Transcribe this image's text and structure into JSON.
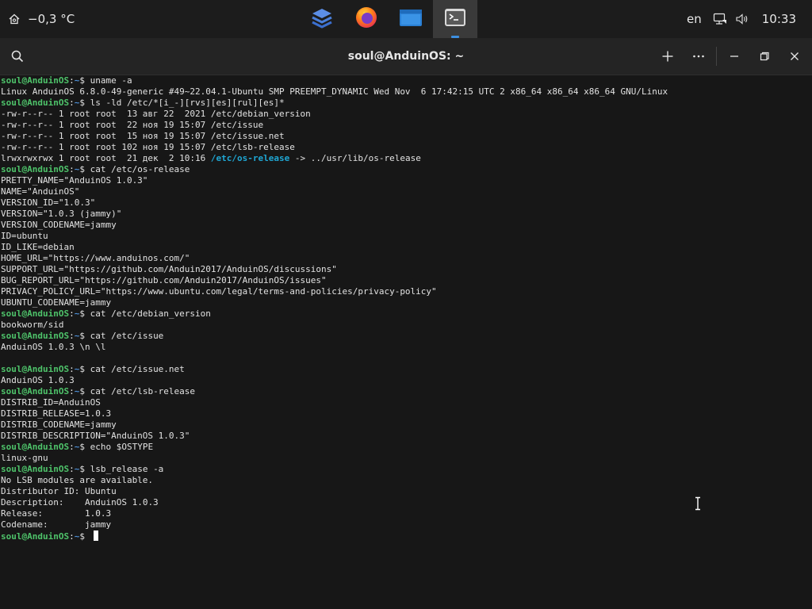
{
  "topbar": {
    "weather_text": "−0,3 °C",
    "dock": [
      {
        "name": "stack-app-icon"
      },
      {
        "name": "firefox-icon"
      },
      {
        "name": "files-icon"
      },
      {
        "name": "terminal-icon",
        "active": true
      }
    ],
    "language": "en",
    "clock": "10:33"
  },
  "window": {
    "title": "soul@AnduinOS: ~"
  },
  "terminal": {
    "prompt_user": "soul@AnduinOS",
    "prompt_path": "~",
    "prompt_symbol": "$",
    "lines": [
      {
        "type": "cmd",
        "text": "uname -a"
      },
      {
        "type": "out",
        "text": "Linux AnduinOS 6.8.0-49-generic #49~22.04.1-Ubuntu SMP PREEMPT_DYNAMIC Wed Nov  6 17:42:15 UTC 2 x86_64 x86_64 x86_64 GNU/Linux"
      },
      {
        "type": "cmd",
        "text": "ls -ld /etc/*[i_-][rvs][es][rul][es]*"
      },
      {
        "type": "out",
        "text": "-rw-r--r-- 1 root root  13 авг 22  2021 /etc/debian_version"
      },
      {
        "type": "out",
        "text": "-rw-r--r-- 1 root root  22 ноя 19 15:07 /etc/issue"
      },
      {
        "type": "out",
        "text": "-rw-r--r-- 1 root root  15 ноя 19 15:07 /etc/issue.net"
      },
      {
        "type": "out",
        "text": "-rw-r--r-- 1 root root 102 ноя 19 15:07 /etc/lsb-release"
      },
      {
        "type": "link",
        "pre": "lrwxrwxrwx 1 root root  21 дек  2 10:16 ",
        "link": "/etc/os-release",
        "post": " -> ../usr/lib/os-release"
      },
      {
        "type": "cmd",
        "text": "cat /etc/os-release"
      },
      {
        "type": "out",
        "text": "PRETTY_NAME=\"AnduinOS 1.0.3\""
      },
      {
        "type": "out",
        "text": "NAME=\"AnduinOS\""
      },
      {
        "type": "out",
        "text": "VERSION_ID=\"1.0.3\""
      },
      {
        "type": "out",
        "text": "VERSION=\"1.0.3 (jammy)\""
      },
      {
        "type": "out",
        "text": "VERSION_CODENAME=jammy"
      },
      {
        "type": "out",
        "text": "ID=ubuntu"
      },
      {
        "type": "out",
        "text": "ID_LIKE=debian"
      },
      {
        "type": "out",
        "text": "HOME_URL=\"https://www.anduinos.com/\""
      },
      {
        "type": "out",
        "text": "SUPPORT_URL=\"https://github.com/Anduin2017/AnduinOS/discussions\""
      },
      {
        "type": "out",
        "text": "BUG_REPORT_URL=\"https://github.com/Anduin2017/AnduinOS/issues\""
      },
      {
        "type": "out",
        "text": "PRIVACY_POLICY_URL=\"https://www.ubuntu.com/legal/terms-and-policies/privacy-policy\""
      },
      {
        "type": "out",
        "text": "UBUNTU_CODENAME=jammy"
      },
      {
        "type": "cmd",
        "text": "cat /etc/debian_version"
      },
      {
        "type": "out",
        "text": "bookworm/sid"
      },
      {
        "type": "cmd",
        "text": "cat /etc/issue"
      },
      {
        "type": "out",
        "text": "AnduinOS 1.0.3 \\n \\l"
      },
      {
        "type": "out",
        "text": ""
      },
      {
        "type": "cmd",
        "text": "cat /etc/issue.net"
      },
      {
        "type": "out",
        "text": "AnduinOS 1.0.3"
      },
      {
        "type": "cmd",
        "text": "cat /etc/lsb-release"
      },
      {
        "type": "out",
        "text": "DISTRIB_ID=AnduinOS"
      },
      {
        "type": "out",
        "text": "DISTRIB_RELEASE=1.0.3"
      },
      {
        "type": "out",
        "text": "DISTRIB_CODENAME=jammy"
      },
      {
        "type": "out",
        "text": "DISTRIB_DESCRIPTION=\"AnduinOS 1.0.3\""
      },
      {
        "type": "cmd",
        "text": "echo $OSTYPE"
      },
      {
        "type": "out",
        "text": "linux-gnu"
      },
      {
        "type": "cmd",
        "text": "lsb_release -a"
      },
      {
        "type": "out",
        "text": "No LSB modules are available."
      },
      {
        "type": "out",
        "text": "Distributor ID:\tUbuntu"
      },
      {
        "type": "out",
        "text": "Description:\tAnduinOS 1.0.3"
      },
      {
        "type": "out",
        "text": "Release:\t1.0.3"
      },
      {
        "type": "out",
        "text": "Codename:\tjammy"
      },
      {
        "type": "prompt",
        "text": ""
      }
    ]
  }
}
